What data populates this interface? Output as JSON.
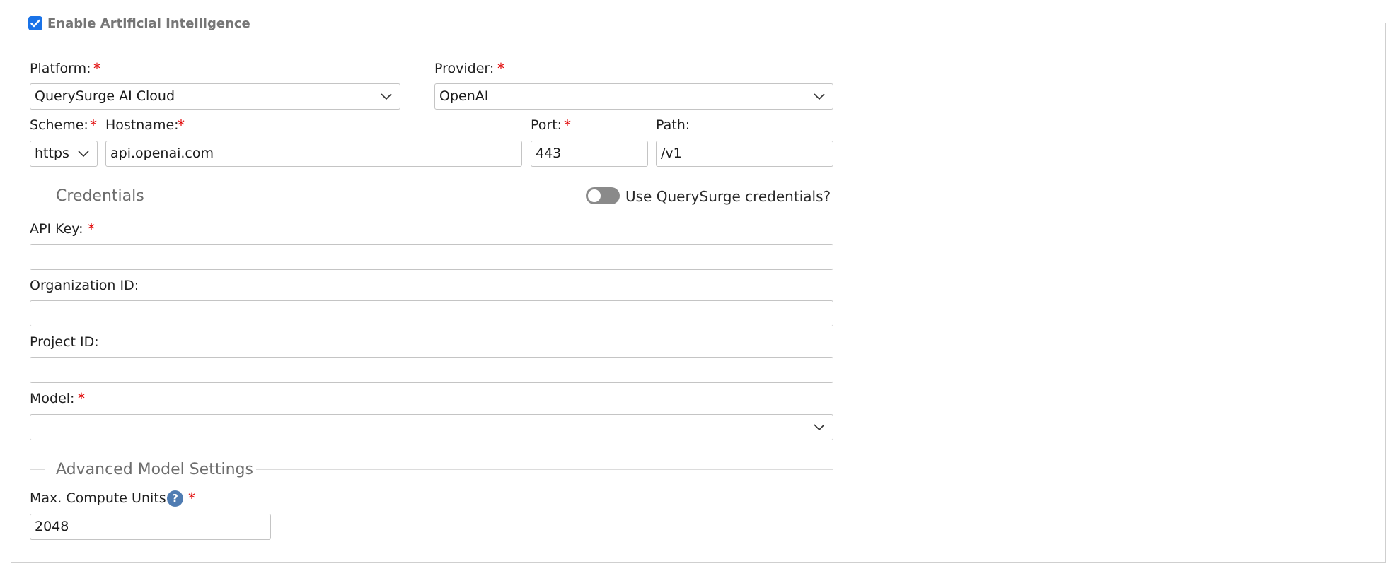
{
  "ai_section": {
    "enable_label": "Enable Artificial Intelligence",
    "enabled": true
  },
  "platform": {
    "label": "Platform:",
    "value": "QuerySurge AI Cloud"
  },
  "provider": {
    "label": "Provider:",
    "value": "OpenAI"
  },
  "scheme": {
    "label": "Scheme:",
    "value": "https"
  },
  "hostname": {
    "label": "Hostname:",
    "value": "api.openai.com"
  },
  "port": {
    "label": "Port:",
    "value": "443"
  },
  "path": {
    "label": "Path:",
    "value": "/v1"
  },
  "credentials": {
    "title": "Credentials",
    "toggle_label": "Use QuerySurge credentials?",
    "toggle_on": false
  },
  "api_key": {
    "label": "API Key:",
    "value": ""
  },
  "organization_id": {
    "label": "Organization ID:",
    "value": ""
  },
  "project_id": {
    "label": "Project ID:",
    "value": ""
  },
  "model": {
    "label": "Model:",
    "value": ""
  },
  "advanced": {
    "title": "Advanced Model Settings"
  },
  "max_compute_units": {
    "label": "Max. Compute Units:",
    "help_icon": "?",
    "value": "2048"
  },
  "required_marker": "*",
  "colors": {
    "accent": "#1a73e8",
    "required": "#e00000",
    "help_icon": "#4f7cb2",
    "toggle_off": "#8a8a8a"
  }
}
